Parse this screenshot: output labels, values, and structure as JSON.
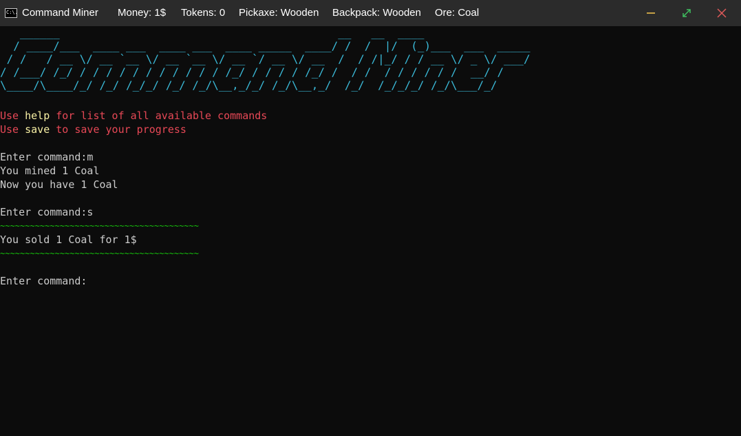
{
  "titlebar": {
    "title": "Command Miner",
    "money": "Money: 1$",
    "tokens": "Tokens: 0",
    "pickaxe": "Pickaxe: Wooden",
    "backpack": "Backpack: Wooden",
    "ore": "Ore: Coal",
    "app_icon": "console-app-icon",
    "app_icon_text": "C:\\."
  },
  "window_controls": {
    "minimize": "minimize-icon",
    "maximize": "maximize-icon",
    "close": "close-icon"
  },
  "colors": {
    "background": "#0c0c0c",
    "titlebar": "#2b2b2b",
    "banner": "#3ab8d6",
    "hint_text": "#e74856",
    "hint_keyword": "#f9f1a5",
    "separator": "#16c60c",
    "output_text": "#cccccc"
  },
  "console": {
    "banner": "   ______                                          __   __  ____\n  / ____/___  ____ ___  ____ ___  ____ _____  ____/ /  /  |/  (_)___  ___  _____\n / /   / __ \\/ __ `__ \\/ __ `__ \\/ __ `/ __ \\/ __  /  / /|_/ / / __ \\/ _ \\/ ___/\n/ /___/ /_/ / / / / / / / / / / / /_/ / / / / /_/ /  / /  / / / / / /  __/ /\n\\____/\\____/_/ /_/ /_/_/ /_/ /_/\\__,_/_/ /_/\\__,_/  /_/  /_/_/_/ /_/\\___/_/",
    "hint1": {
      "prefix": "Use ",
      "keyword": "help",
      "suffix": " for list of all available commands"
    },
    "hint2": {
      "prefix": "Use ",
      "keyword": "save",
      "suffix": " to save your progress"
    },
    "prompt1": "Enter command:m",
    "output1": "You mined 1 Coal",
    "output2": "Now you have 1 Coal",
    "prompt2": "Enter command:s",
    "separator": "~~~~~~~~~~~~~~~~~~~~~~~~~~~~~~~~~~~~~~~~",
    "output3": "You sold 1 Coal for 1$",
    "prompt3": "Enter command:"
  }
}
